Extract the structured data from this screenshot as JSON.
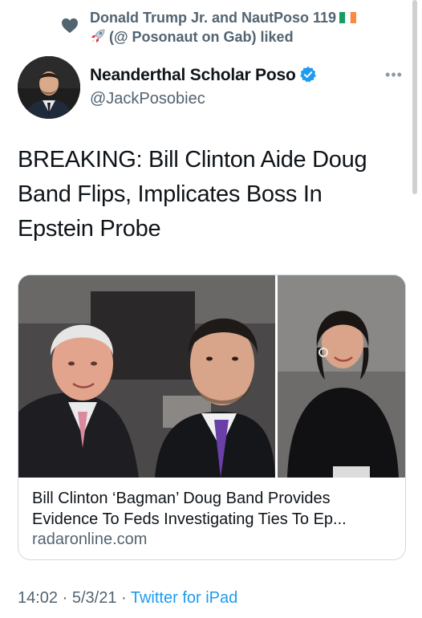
{
  "social_context": {
    "liked_line1": "Donald Trump Jr. and NautPoso 119",
    "liked_line2": "(@ Posonaut on Gab) liked",
    "flag_colors": [
      "#169b62",
      "#ffffff",
      "#ff883e"
    ],
    "heart_icon": "heart-icon",
    "rocket_icon": "rocket-icon"
  },
  "author": {
    "display_name": "Neanderthal Scholar Poso",
    "handle": "@JackPosobiec",
    "verified": true,
    "verified_color": "#1d9bf0"
  },
  "more_button": "•••",
  "tweet": {
    "text": "BREAKING: Bill Clinton Aide Doug Band Flips, Implicates Boss In Epstein Probe"
  },
  "link_card": {
    "title": "Bill Clinton ‘Bagman’ Doug Band Provides Evidence To Feds Investigating Ties To Ep...",
    "domain": "radaronline.com"
  },
  "meta": {
    "time": "14:02",
    "sep1": " · ",
    "date": "5/3/21",
    "sep2": " · ",
    "source": "Twitter for iPad"
  },
  "colors": {
    "text_primary": "#0f1419",
    "text_secondary": "#536471",
    "accent": "#1d9bf0",
    "border": "#cfd9de"
  }
}
